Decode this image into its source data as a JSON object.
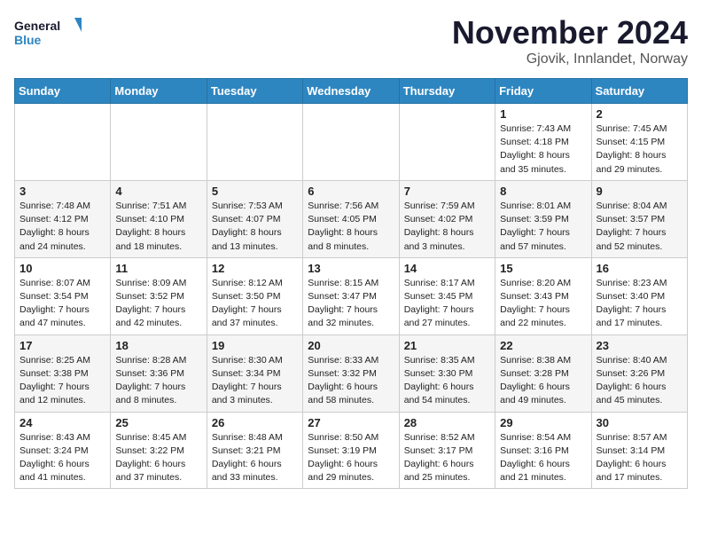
{
  "logo": {
    "line1": "General",
    "line2": "Blue"
  },
  "title": "November 2024",
  "subtitle": "Gjovik, Innlandet, Norway",
  "header_color": "#2e86c1",
  "days_of_week": [
    "Sunday",
    "Monday",
    "Tuesday",
    "Wednesday",
    "Thursday",
    "Friday",
    "Saturday"
  ],
  "rows": [
    [
      {
        "day": "",
        "info": ""
      },
      {
        "day": "",
        "info": ""
      },
      {
        "day": "",
        "info": ""
      },
      {
        "day": "",
        "info": ""
      },
      {
        "day": "",
        "info": ""
      },
      {
        "day": "1",
        "info": "Sunrise: 7:43 AM\nSunset: 4:18 PM\nDaylight: 8 hours and 35 minutes."
      },
      {
        "day": "2",
        "info": "Sunrise: 7:45 AM\nSunset: 4:15 PM\nDaylight: 8 hours and 29 minutes."
      }
    ],
    [
      {
        "day": "3",
        "info": "Sunrise: 7:48 AM\nSunset: 4:12 PM\nDaylight: 8 hours and 24 minutes."
      },
      {
        "day": "4",
        "info": "Sunrise: 7:51 AM\nSunset: 4:10 PM\nDaylight: 8 hours and 18 minutes."
      },
      {
        "day": "5",
        "info": "Sunrise: 7:53 AM\nSunset: 4:07 PM\nDaylight: 8 hours and 13 minutes."
      },
      {
        "day": "6",
        "info": "Sunrise: 7:56 AM\nSunset: 4:05 PM\nDaylight: 8 hours and 8 minutes."
      },
      {
        "day": "7",
        "info": "Sunrise: 7:59 AM\nSunset: 4:02 PM\nDaylight: 8 hours and 3 minutes."
      },
      {
        "day": "8",
        "info": "Sunrise: 8:01 AM\nSunset: 3:59 PM\nDaylight: 7 hours and 57 minutes."
      },
      {
        "day": "9",
        "info": "Sunrise: 8:04 AM\nSunset: 3:57 PM\nDaylight: 7 hours and 52 minutes."
      }
    ],
    [
      {
        "day": "10",
        "info": "Sunrise: 8:07 AM\nSunset: 3:54 PM\nDaylight: 7 hours and 47 minutes."
      },
      {
        "day": "11",
        "info": "Sunrise: 8:09 AM\nSunset: 3:52 PM\nDaylight: 7 hours and 42 minutes."
      },
      {
        "day": "12",
        "info": "Sunrise: 8:12 AM\nSunset: 3:50 PM\nDaylight: 7 hours and 37 minutes."
      },
      {
        "day": "13",
        "info": "Sunrise: 8:15 AM\nSunset: 3:47 PM\nDaylight: 7 hours and 32 minutes."
      },
      {
        "day": "14",
        "info": "Sunrise: 8:17 AM\nSunset: 3:45 PM\nDaylight: 7 hours and 27 minutes."
      },
      {
        "day": "15",
        "info": "Sunrise: 8:20 AM\nSunset: 3:43 PM\nDaylight: 7 hours and 22 minutes."
      },
      {
        "day": "16",
        "info": "Sunrise: 8:23 AM\nSunset: 3:40 PM\nDaylight: 7 hours and 17 minutes."
      }
    ],
    [
      {
        "day": "17",
        "info": "Sunrise: 8:25 AM\nSunset: 3:38 PM\nDaylight: 7 hours and 12 minutes."
      },
      {
        "day": "18",
        "info": "Sunrise: 8:28 AM\nSunset: 3:36 PM\nDaylight: 7 hours and 8 minutes."
      },
      {
        "day": "19",
        "info": "Sunrise: 8:30 AM\nSunset: 3:34 PM\nDaylight: 7 hours and 3 minutes."
      },
      {
        "day": "20",
        "info": "Sunrise: 8:33 AM\nSunset: 3:32 PM\nDaylight: 6 hours and 58 minutes."
      },
      {
        "day": "21",
        "info": "Sunrise: 8:35 AM\nSunset: 3:30 PM\nDaylight: 6 hours and 54 minutes."
      },
      {
        "day": "22",
        "info": "Sunrise: 8:38 AM\nSunset: 3:28 PM\nDaylight: 6 hours and 49 minutes."
      },
      {
        "day": "23",
        "info": "Sunrise: 8:40 AM\nSunset: 3:26 PM\nDaylight: 6 hours and 45 minutes."
      }
    ],
    [
      {
        "day": "24",
        "info": "Sunrise: 8:43 AM\nSunset: 3:24 PM\nDaylight: 6 hours and 41 minutes."
      },
      {
        "day": "25",
        "info": "Sunrise: 8:45 AM\nSunset: 3:22 PM\nDaylight: 6 hours and 37 minutes."
      },
      {
        "day": "26",
        "info": "Sunrise: 8:48 AM\nSunset: 3:21 PM\nDaylight: 6 hours and 33 minutes."
      },
      {
        "day": "27",
        "info": "Sunrise: 8:50 AM\nSunset: 3:19 PM\nDaylight: 6 hours and 29 minutes."
      },
      {
        "day": "28",
        "info": "Sunrise: 8:52 AM\nSunset: 3:17 PM\nDaylight: 6 hours and 25 minutes."
      },
      {
        "day": "29",
        "info": "Sunrise: 8:54 AM\nSunset: 3:16 PM\nDaylight: 6 hours and 21 minutes."
      },
      {
        "day": "30",
        "info": "Sunrise: 8:57 AM\nSunset: 3:14 PM\nDaylight: 6 hours and 17 minutes."
      }
    ]
  ]
}
